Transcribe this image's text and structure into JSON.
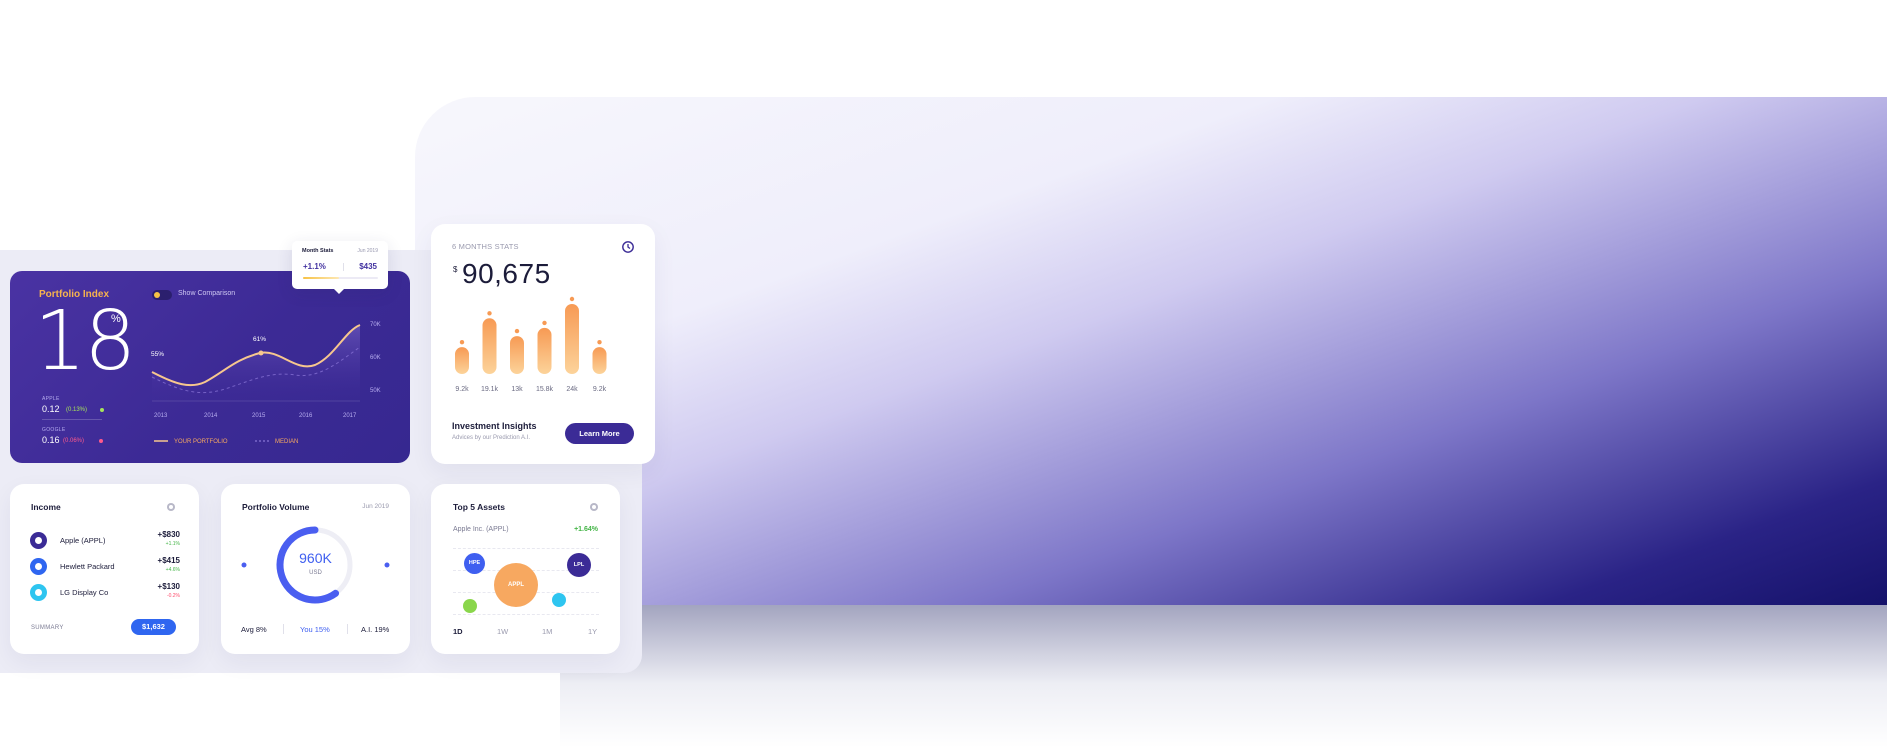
{
  "portfolio_index": {
    "title": "Portfolio Index",
    "toggle_label": "Show Comparison",
    "value": "18",
    "unit": "%",
    "stocks": [
      {
        "name": "APPLE",
        "value": "0.12",
        "change": "(0.13%)",
        "change_color": "#a6e35b"
      },
      {
        "name": "GOOGLE",
        "value": "0.16",
        "change": "(0.06%)",
        "change_color": "#ff5a8c"
      }
    ],
    "chart": {
      "x_labels": [
        "2013",
        "2014",
        "2015",
        "2016",
        "2017"
      ],
      "y_labels": [
        "70K",
        "60K",
        "50K"
      ],
      "point_labels": [
        "55%",
        "61%"
      ],
      "legend": [
        "YOUR PORTFOLIO",
        "MEDIAN"
      ]
    }
  },
  "tooltip": {
    "title": "Month Stats",
    "date": "Jun 2019",
    "change": "+1.1%",
    "amount": "$435"
  },
  "six_months": {
    "label": "6 MONTHS STATS",
    "currency": "$",
    "value": "90,675",
    "bars": [
      {
        "label": "9.2k",
        "value": 9.2
      },
      {
        "label": "19.1k",
        "value": 19.1
      },
      {
        "label": "13k",
        "value": 13
      },
      {
        "label": "15.8k",
        "value": 15.8
      },
      {
        "label": "24k",
        "value": 24
      },
      {
        "label": "9.2k",
        "value": 9.2
      }
    ],
    "insights_title": "Investment Insights",
    "insights_sub": "Advices by our Prediction A.I.",
    "button": "Learn More"
  },
  "income": {
    "title": "Income",
    "rows": [
      {
        "name": "Apple (APPL)",
        "value": "+$830",
        "change": "+1.1%",
        "change_color": "#44b547",
        "icon_color": "#3b2b96",
        "icon": "apple-icon"
      },
      {
        "name": "Hewlett Packard",
        "value": "+$415",
        "change": "+4.6%",
        "change_color": "#44b547",
        "icon_color": "#2f66f0",
        "icon": "hp-icon"
      },
      {
        "name": "LG Display Co",
        "value": "+$130",
        "change": "-0.2%",
        "change_color": "#ff4d6d",
        "icon_color": "#2ec5f0",
        "icon": "lg-icon"
      }
    ],
    "summary_label": "SUMMARY",
    "summary_value": "$1,632"
  },
  "volume": {
    "title": "Portfolio Volume",
    "date": "Jun 2019",
    "value": "960K",
    "unit": "USD",
    "ring_fraction": 0.6,
    "footer": [
      {
        "label": "Avg  8%"
      },
      {
        "label": "You 15%"
      },
      {
        "label": "A.I. 19%"
      }
    ]
  },
  "assets": {
    "title": "Top 5 Assets",
    "subtitle": "Apple Inc. (APPL)",
    "change": "+1.64%",
    "bubbles": [
      {
        "label": "HPE",
        "color": "#3f5ff0"
      },
      {
        "label": "APPL",
        "color": "#f7a860"
      },
      {
        "label": "LPL",
        "color": "#3b2b96"
      },
      {
        "label": "",
        "color": "#8ad64b"
      },
      {
        "label": "",
        "color": "#2ec5f0"
      }
    ],
    "tabs": [
      "1D",
      "1W",
      "1M",
      "1Y"
    ]
  },
  "colors": {
    "primary": "#3b2b96",
    "accent": "#f7a860",
    "blue": "#2f66f0"
  }
}
